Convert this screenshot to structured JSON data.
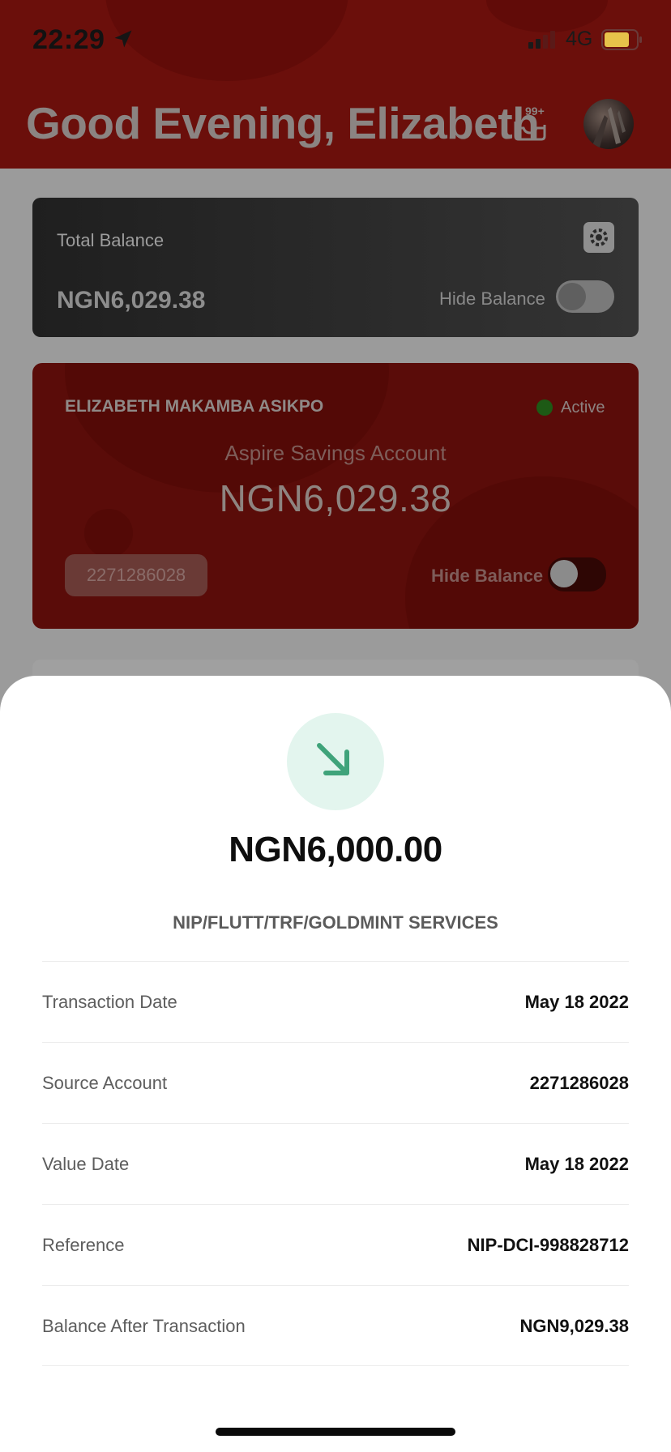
{
  "status_bar": {
    "time": "22:29",
    "network": "4G",
    "icons": [
      "location-arrow-icon",
      "signal-icon",
      "battery-icon"
    ]
  },
  "header": {
    "greeting": "Good Evening, Elizabeth",
    "notification_badge": "99+",
    "icons": [
      "notification-tray-icon",
      "avatar"
    ]
  },
  "total_balance_card": {
    "label": "Total Balance",
    "amount": "NGN6,029.38",
    "hide_label": "Hide Balance",
    "hide_on": false,
    "icon": "gear-icon"
  },
  "account_card": {
    "holder_name": "ELIZABETH MAKAMBA ASIKPO",
    "status": "Active",
    "account_type": "Aspire Savings Account",
    "balance": "NGN6,029.38",
    "account_number": "2271286028",
    "hide_label": "Hide Balance",
    "hide_on": false
  },
  "transaction_sheet": {
    "icon": "arrow-down-right-icon",
    "amount": "NGN6,000.00",
    "description": "NIP/FLUTT/TRF/GOLDMINT SERVICES",
    "details": [
      {
        "label": "Transaction Date",
        "value": "May 18 2022"
      },
      {
        "label": "Source Account",
        "value": "2271286028"
      },
      {
        "label": "Value Date",
        "value": "May 18 2022"
      },
      {
        "label": "Reference",
        "value": "NIP-DCI-998828712"
      },
      {
        "label": "Balance After Transaction",
        "value": "NGN9,029.38"
      }
    ]
  },
  "colors": {
    "header_red": "#6b0f0b",
    "accent_green": "#3fa37a",
    "icon_bg": "#e3f5ee"
  }
}
